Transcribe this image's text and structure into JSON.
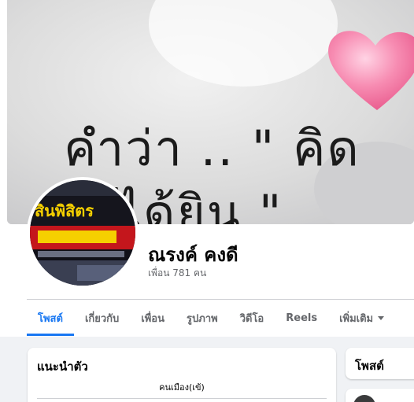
{
  "cover": {
    "line1": "คำว่า .. \" คิด",
    "line2": "ได้ยิน \""
  },
  "avatar": {
    "sign_text": "สินพิสิตร"
  },
  "profile": {
    "name": "ณรงค์ คงดี",
    "friends": "เพื่อน 781 คน"
  },
  "tabs": [
    {
      "label": "โพสต์",
      "active": true
    },
    {
      "label": "เกี่ยวกับ"
    },
    {
      "label": "เพื่อน"
    },
    {
      "label": "รูปภาพ"
    },
    {
      "label": "วิดีโอ"
    },
    {
      "label": "Reels"
    },
    {
      "label": "เพิ่มเติม"
    }
  ],
  "intro": {
    "title": "แนะนำตัว",
    "bio": "คนเมือง(เข้)"
  },
  "posts_card": {
    "title": "โพสต์"
  },
  "colors": {
    "accent": "#1877f2",
    "heart": "#f26b9a"
  }
}
